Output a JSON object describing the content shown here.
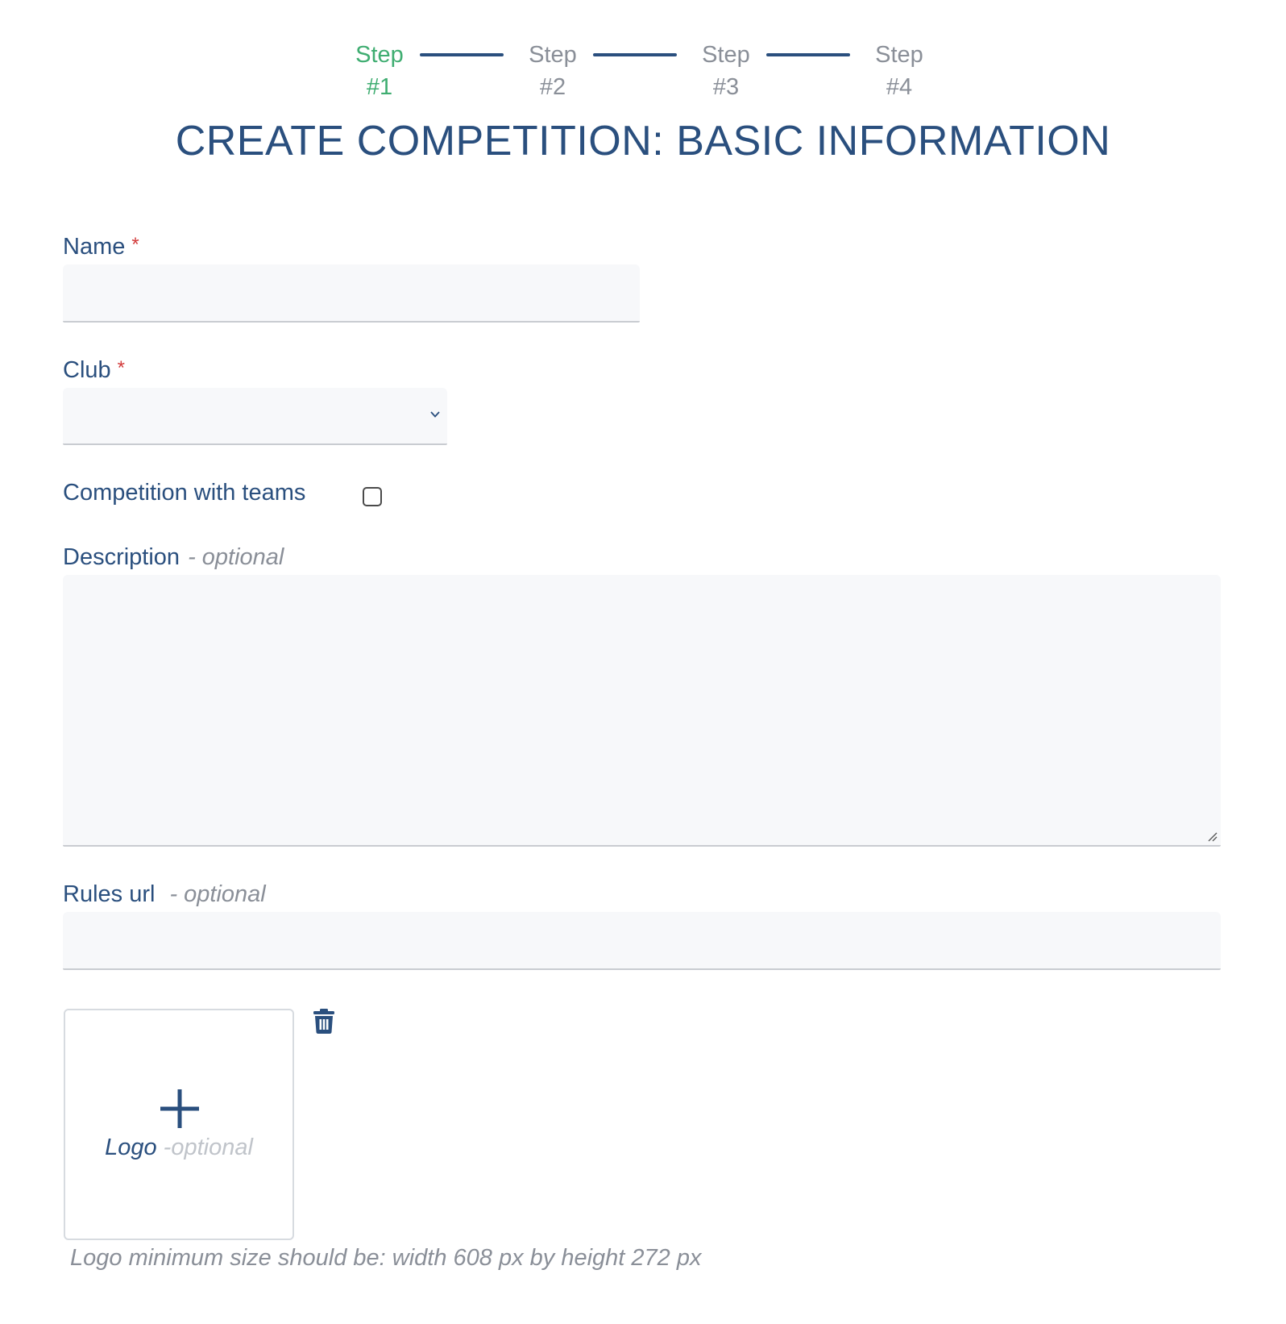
{
  "stepper": {
    "steps": [
      {
        "word": "Step",
        "num": "#1",
        "active": true
      },
      {
        "word": "Step",
        "num": "#2",
        "active": false
      },
      {
        "word": "Step",
        "num": "#3",
        "active": false
      },
      {
        "word": "Step",
        "num": "#4",
        "active": false
      }
    ]
  },
  "page_title": "CREATE COMPETITION: BASIC INFORMATION",
  "form": {
    "name": {
      "label": "Name",
      "required_mark": "*",
      "value": ""
    },
    "club": {
      "label": "Club",
      "required_mark": "*",
      "selected": ""
    },
    "teams": {
      "label": "Competition with teams",
      "checked": false
    },
    "description": {
      "label": "Description",
      "optional": "- optional",
      "value": ""
    },
    "rules_url": {
      "label": "Rules url",
      "optional": "- optional",
      "value": ""
    },
    "logo": {
      "label": "Logo",
      "optional": "-optional",
      "hint": "Logo minimum size should be: width 608 px by height 272 px"
    }
  },
  "colors": {
    "primary": "#2a4f7e",
    "active_step": "#3fad71",
    "muted": "#8a8f98",
    "required": "#d23b3b",
    "field_bg": "#f7f8fa"
  },
  "icons": {
    "select": "chevron-down-icon",
    "resize": "resize-grip-icon",
    "add": "plus-icon",
    "delete": "trash-icon"
  }
}
